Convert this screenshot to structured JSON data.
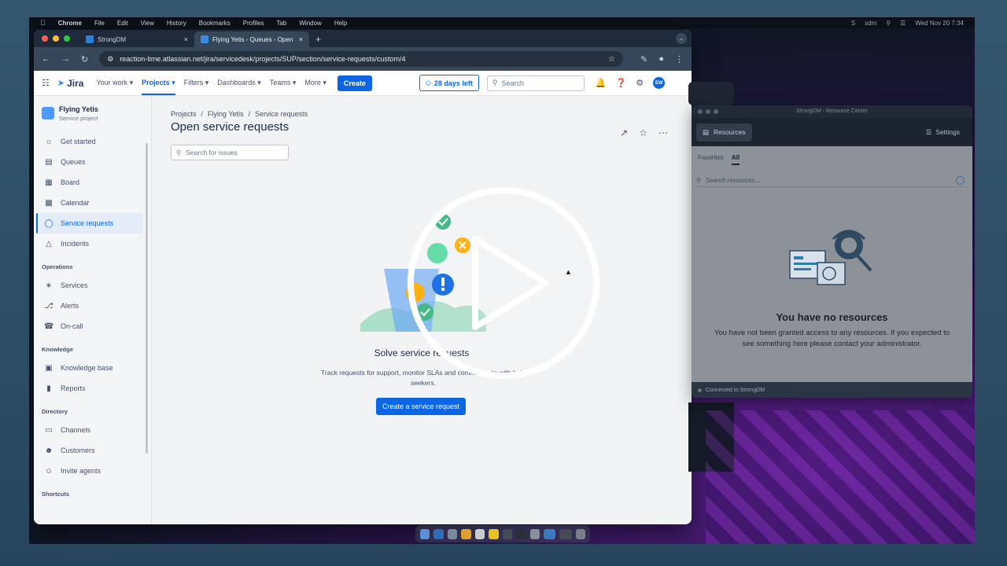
{
  "menubar": {
    "app": "Chrome",
    "items": [
      "File",
      "Edit",
      "View",
      "History",
      "Bookmarks",
      "Profiles",
      "Tab",
      "Window",
      "Help"
    ],
    "right": [
      "sdm",
      "Wed Nov 20  7:34"
    ]
  },
  "browser": {
    "tabs": [
      {
        "label": "StrongDM",
        "active": false
      },
      {
        "label": "Flying Yetis - Queues - Open",
        "active": true
      }
    ],
    "url": "reaction-time.atlassian.net/jira/servicedesk/projects/SUP/section/service-requests/custom/4"
  },
  "jira_nav": {
    "logo": "Jira",
    "items": [
      "Your work",
      "Projects",
      "Filters",
      "Dashboards",
      "Teams",
      "More"
    ],
    "active_item": "Projects",
    "create_label": "Create",
    "trial_label": "28 days left",
    "search_placeholder": "Search",
    "avatar_initials": "EW"
  },
  "sidebar": {
    "project_name": "Flying Yetis",
    "project_type": "Service project",
    "items": [
      {
        "label": "Get started",
        "icon": "compass-icon"
      },
      {
        "label": "Queues",
        "icon": "queue-icon"
      },
      {
        "label": "Board",
        "icon": "board-icon"
      },
      {
        "label": "Calendar",
        "icon": "calendar-icon"
      },
      {
        "label": "Service requests",
        "icon": "chat-icon",
        "active": true
      },
      {
        "label": "Incidents",
        "icon": "warning-icon"
      }
    ],
    "sections": [
      {
        "title": "Operations",
        "items": [
          {
            "label": "Services",
            "icon": "services-icon"
          },
          {
            "label": "Alerts",
            "icon": "bell-icon"
          },
          {
            "label": "On-call",
            "icon": "phone-icon"
          }
        ]
      },
      {
        "title": "Knowledge",
        "items": [
          {
            "label": "Knowledge base",
            "icon": "book-icon"
          },
          {
            "label": "Reports",
            "icon": "chart-icon"
          }
        ]
      },
      {
        "title": "Directory",
        "items": [
          {
            "label": "Channels",
            "icon": "monitor-icon"
          },
          {
            "label": "Customers",
            "icon": "people-icon"
          },
          {
            "label": "Invite agents",
            "icon": "person-add-icon"
          }
        ]
      },
      {
        "title": "Shortcuts",
        "items": []
      }
    ]
  },
  "main": {
    "breadcrumb": [
      "Projects",
      "Flying Yetis",
      "Service requests"
    ],
    "title": "Open service requests",
    "search_placeholder": "Search for issues",
    "empty_title": "Solve service requests",
    "empty_desc": "Track requests for support, monitor SLAs and communicate with help seekers.",
    "cta": "Create a service request"
  },
  "strongdm": {
    "window_title": "StrongDM - Resource Center",
    "resources_btn": "Resources",
    "settings_label": "Settings",
    "tabs": [
      "Favorites",
      "All"
    ],
    "active_tab": "All",
    "search_placeholder": "Search resources...",
    "empty_title": "You have no resources",
    "empty_desc": "You have not been granted access to any resources. If you expected to see something here please contact your administrator.",
    "status": "Connected to StrongDM"
  },
  "colors": {
    "jira_blue": "#0c66e4",
    "sidebar_active_bg": "#e4ecfa"
  }
}
